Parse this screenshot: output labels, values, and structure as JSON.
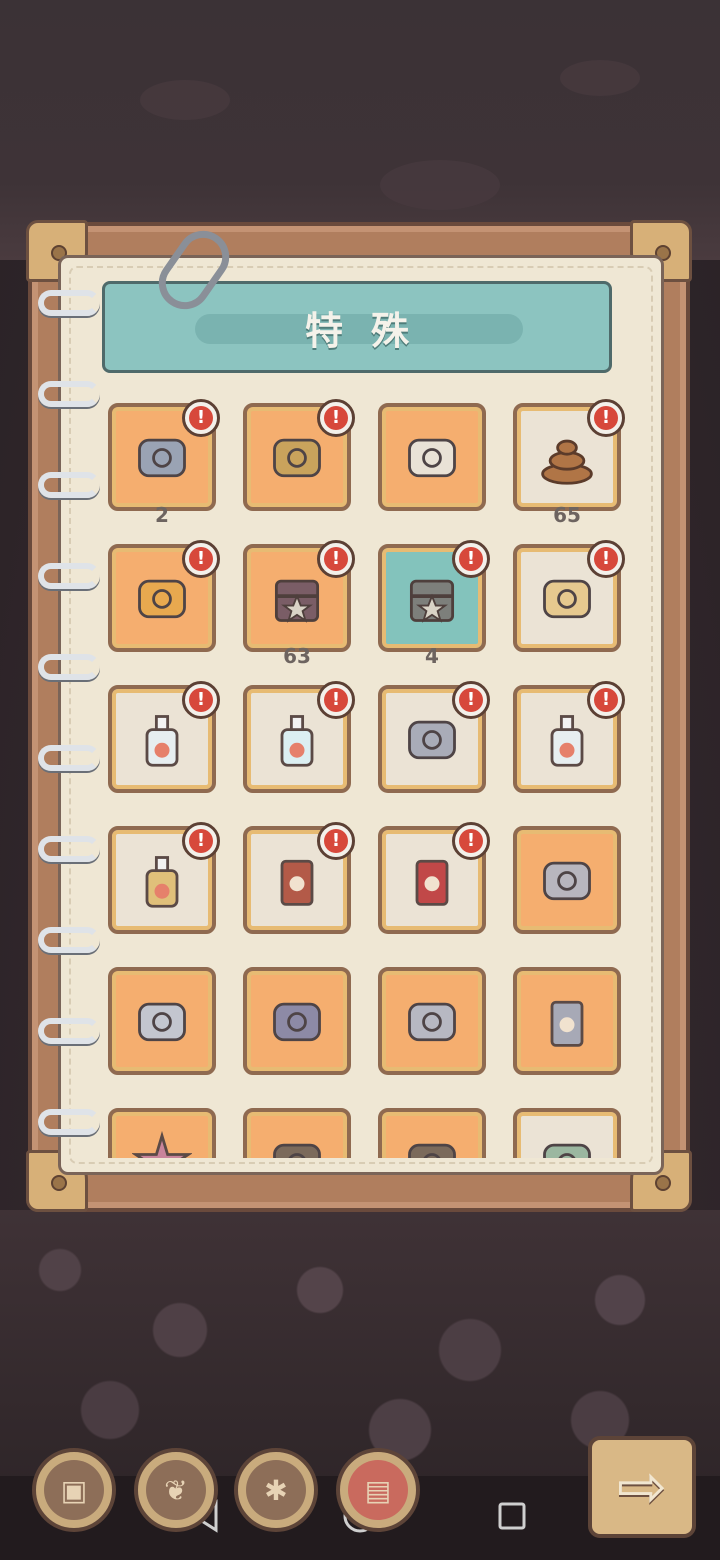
{
  "title": "特殊",
  "items": [
    {
      "name": "stone-ore-icon",
      "bg": "orange",
      "alert": true,
      "count": "2"
    },
    {
      "name": "log-branch-icon",
      "bg": "orange",
      "alert": true,
      "count": ""
    },
    {
      "name": "tag-note-icon",
      "bg": "orange",
      "alert": false,
      "count": ""
    },
    {
      "name": "dung-pile-icon",
      "bg": "cream",
      "alert": true,
      "count": "65"
    },
    {
      "name": "golden-medal-icon",
      "bg": "orange",
      "alert": true,
      "count": ""
    },
    {
      "name": "locked-chest-icon",
      "bg": "orange",
      "alert": true,
      "count": "63"
    },
    {
      "name": "star-chest-icon",
      "bg": "teal",
      "alert": true,
      "count": "4"
    },
    {
      "name": "scroll-map-icon",
      "bg": "cream",
      "alert": true,
      "count": ""
    },
    {
      "name": "soap-bottle-icon",
      "bg": "cream",
      "alert": true,
      "count": ""
    },
    {
      "name": "soap-bottle-blue-icon",
      "bg": "cream",
      "alert": true,
      "count": ""
    },
    {
      "name": "metal-brick-icon",
      "bg": "cream",
      "alert": true,
      "count": ""
    },
    {
      "name": "soap-bottle-red-icon",
      "bg": "cream",
      "alert": true,
      "count": ""
    },
    {
      "name": "glue-bottle-icon",
      "bg": "cream",
      "alert": true,
      "count": ""
    },
    {
      "name": "paint-can-icon",
      "bg": "cream",
      "alert": true,
      "count": ""
    },
    {
      "name": "red-can-icon",
      "bg": "cream",
      "alert": true,
      "count": ""
    },
    {
      "name": "stacked-parts-icon",
      "bg": "orange",
      "alert": false,
      "count": ""
    },
    {
      "name": "metal-clamp-icon",
      "bg": "orange",
      "alert": false,
      "count": ""
    },
    {
      "name": "battery-icon",
      "bg": "orange",
      "alert": false,
      "count": ""
    },
    {
      "name": "metal-block-icon",
      "bg": "orange",
      "alert": false,
      "count": ""
    },
    {
      "name": "cannon-part-icon",
      "bg": "orange",
      "alert": false,
      "count": ""
    },
    {
      "name": "starfish-icon",
      "bg": "orange",
      "alert": false,
      "count": ""
    },
    {
      "name": "bone-stick-icon",
      "bg": "orange",
      "alert": false,
      "count": ""
    },
    {
      "name": "bone-stick-icon",
      "bg": "orange",
      "alert": false,
      "count": ""
    },
    {
      "name": "spring-coil-icon",
      "bg": "cream",
      "alert": false,
      "count": ""
    }
  ],
  "alert_symbol": "!",
  "toolbar": [
    {
      "name": "backpack-button"
    },
    {
      "name": "herb-branch-button"
    },
    {
      "name": "gear-parts-button"
    },
    {
      "name": "treasure-chest-button"
    }
  ],
  "next_label": "⇨",
  "colors": {
    "accent": "#f5ae6f",
    "alert": "#d7483b",
    "teal": "#83c3bc"
  }
}
